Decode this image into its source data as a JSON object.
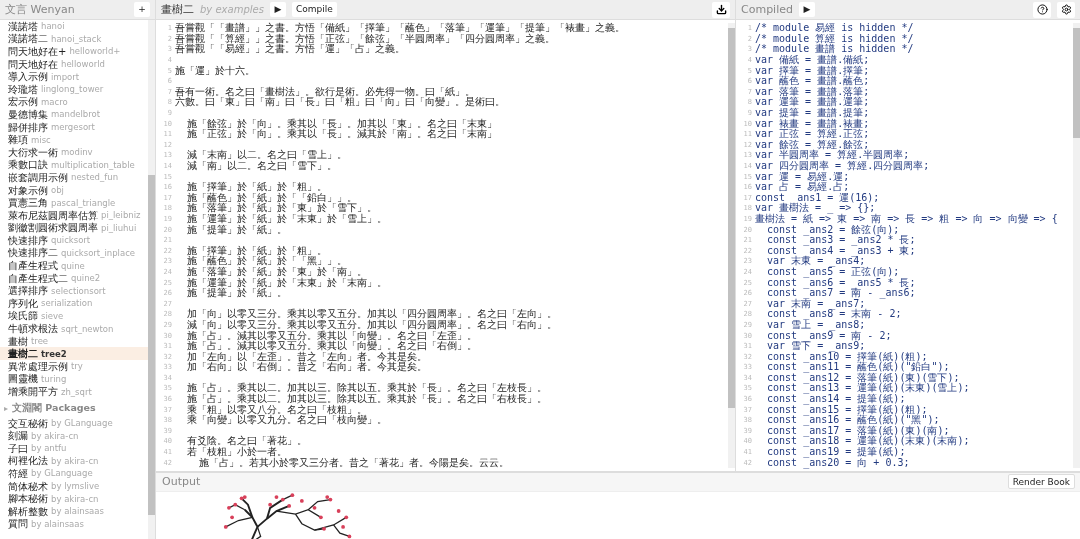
{
  "sidebar": {
    "title": "文言 Wenyan",
    "add_button": "+",
    "examples": [
      {
        "name": "漢諾塔",
        "slug": "hanoi",
        "selected": false
      },
      {
        "name": "漢諾塔二",
        "slug": "hanoi_stack",
        "selected": false
      },
      {
        "name": "問天地好在+",
        "slug": "helloworld+",
        "selected": false
      },
      {
        "name": "問天地好在",
        "slug": "helloworld",
        "selected": false
      },
      {
        "name": "導入示例",
        "slug": "import",
        "selected": false
      },
      {
        "name": "玲瓏塔",
        "slug": "linglong_tower",
        "selected": false
      },
      {
        "name": "宏示例",
        "slug": "macro",
        "selected": false
      },
      {
        "name": "曼德博集",
        "slug": "mandelbrot",
        "selected": false
      },
      {
        "name": "歸併排序",
        "slug": "mergesort",
        "selected": false
      },
      {
        "name": "雜項",
        "slug": "misc",
        "selected": false
      },
      {
        "name": "大衍求一術",
        "slug": "modinv",
        "selected": false
      },
      {
        "name": "乘數口訣",
        "slug": "multiplication_table",
        "selected": false
      },
      {
        "name": "嵌套調用示例",
        "slug": "nested_fun",
        "selected": false
      },
      {
        "name": "对象示例",
        "slug": "obj",
        "selected": false
      },
      {
        "name": "賈憲三角",
        "slug": "pascal_triangle",
        "selected": false
      },
      {
        "name": "萊布尼茲圓周率估算",
        "slug": "pi_leibniz",
        "selected": false
      },
      {
        "name": "劉徽割圓術求圓周率",
        "slug": "pi_liuhui",
        "selected": false
      },
      {
        "name": "快速排序",
        "slug": "quicksort",
        "selected": false
      },
      {
        "name": "快速排序二",
        "slug": "quicksort_inplace",
        "selected": false
      },
      {
        "name": "自產生程式",
        "slug": "quine",
        "selected": false
      },
      {
        "name": "自產生程式二",
        "slug": "quine2",
        "selected": false
      },
      {
        "name": "選擇排序",
        "slug": "selectionsort",
        "selected": false
      },
      {
        "name": "序列化",
        "slug": "serialization",
        "selected": false
      },
      {
        "name": "埃氏篩",
        "slug": "sieve",
        "selected": false
      },
      {
        "name": "牛頓求根法",
        "slug": "sqrt_newton",
        "selected": false
      },
      {
        "name": "畫樹",
        "slug": "tree",
        "selected": false
      },
      {
        "name": "畫樹二",
        "slug": "tree2",
        "selected": true
      },
      {
        "name": "異常處理示例",
        "slug": "try",
        "selected": false
      },
      {
        "name": "圖靈機",
        "slug": "turing",
        "selected": false
      },
      {
        "name": "增乘開平方",
        "slug": "zh_sqrt",
        "selected": false
      }
    ],
    "packages": {
      "toggle": "▸",
      "title": "文淵閣 Packages",
      "items": [
        {
          "name": "交互秘術",
          "author": "by GLanguage"
        },
        {
          "name": "刻漏",
          "author": "by akira-cn"
        },
        {
          "name": "子曰",
          "author": "by antfu"
        },
        {
          "name": "柯裡化法",
          "author": "by akira-cn"
        },
        {
          "name": "符經",
          "author": "by GLanguage"
        },
        {
          "name": "简体秘术",
          "author": "by lymslive"
        },
        {
          "name": "腳本秘術",
          "author": "by akira-cn"
        },
        {
          "name": "解析整數",
          "author": "by alainsaas"
        },
        {
          "name": "質問",
          "author": "by alainsaas"
        }
      ]
    }
  },
  "editor": {
    "title": "畫樹二",
    "author": "by examples",
    "run_button": "▶",
    "compile_button": "Compile",
    "lines": [
      {
        "no": "1",
        "text": "吾嘗觀「「畫譜」」之書。方悟「備紙」「擇筆」「蘸色」「落筆」「運筆」「提筆」「裱畫」之義。"
      },
      {
        "no": "2",
        "text": "吾嘗觀「「算經」」之書。方悟「正弦」「餘弦」「半圓周率」「四分圓周率」之義。"
      },
      {
        "no": "3",
        "text": "吾嘗觀「「易經」」之書。方悟「運」「占」之義。"
      },
      {
        "no": "4"
      },
      {
        "no": "5",
        "text": "施「運」於十六。"
      },
      {
        "no": "6"
      },
      {
        "no": "7",
        "text": "吾有一術。名之曰「畫樹法」。欲行是術。必先得一物。曰「紙」。"
      },
      {
        "no": "8",
        "text": "六數。曰「東」曰「南」曰「長」曰「粗」曰「向」曰「向變」。是術曰。"
      },
      {
        "no": "9"
      },
      {
        "no": "10",
        "text": "  施「餘弦」於「向」。乘其以「長」。加其以「東」。名之曰「末東」"
      },
      {
        "no": "11",
        "text": "  施「正弦」於「向」。乘其以「長」。減其於「南」。名之曰「末南」"
      },
      {
        "no": "12"
      },
      {
        "no": "13",
        "text": "  減「末南」以二。名之曰「雪上」。"
      },
      {
        "no": "14",
        "text": "  減「南」以二。名之曰「雪下」。"
      },
      {
        "no": "15"
      },
      {
        "no": "16",
        "text": "  施「擇筆」於「紙」於「粗」。"
      },
      {
        "no": "17",
        "text": "  施「蘸色」於「紙」於「「鉛白」」。"
      },
      {
        "no": "18",
        "text": "  施「落筆」於「紙」於「東」於「雪下」。"
      },
      {
        "no": "19",
        "text": "  施「運筆」於「紙」於「末東」於「雪上」。"
      },
      {
        "no": "20",
        "text": "  施「提筆」於「紙」。"
      },
      {
        "no": "21"
      },
      {
        "no": "22",
        "text": "  施「擇筆」於「紙」於「粗」。"
      },
      {
        "no": "23",
        "text": "  施「蘸色」於「紙」於「「黑」」。"
      },
      {
        "no": "24",
        "text": "  施「落筆」於「紙」於「東」於「南」。"
      },
      {
        "no": "25",
        "text": "  施「運筆」於「紙」於「末東」於「末南」。"
      },
      {
        "no": "26",
        "text": "  施「提筆」於「紙」。"
      },
      {
        "no": "27"
      },
      {
        "no": "28",
        "text": "  加「向」以零又三分。乘其以零又五分。加其以「四分圓周率」。名之曰「左向」。"
      },
      {
        "no": "29",
        "text": "  減「向」以零又三分。乘其以零又五分。加其以「四分圓周率」。名之曰「右向」。"
      },
      {
        "no": "30",
        "text": "  施「占」。減其以零又五分。乘其以「向變」。名之曰「左歪」。"
      },
      {
        "no": "31",
        "text": "  施「占」。減其以零又五分。乘其以「向變」。名之曰「右倒」。"
      },
      {
        "no": "32",
        "text": "  加「左向」以「左歪」。昔之「左向」者。今其是矣。"
      },
      {
        "no": "33",
        "text": "  加「右向」以「右倒」。昔之「右向」者。今其是矣。"
      },
      {
        "no": "34"
      },
      {
        "no": "35",
        "text": "  施「占」。乘其以二。加其以三。除其以五。乘其於「長」。名之曰「左枝長」。"
      },
      {
        "no": "36",
        "text": "  施「占」。乘其以二。加其以三。除其以五。乘其於「長」。名之曰「右枝長」。"
      },
      {
        "no": "37",
        "text": "  乘「粗」以零又八分。名之曰「枝粗」。"
      },
      {
        "no": "38",
        "text": "  乘「向變」以零又九分。名之曰「枝向變」。"
      },
      {
        "no": "39"
      },
      {
        "no": "40",
        "text": "  有爻陰。名之曰「著花」。"
      },
      {
        "no": "41",
        "text": "  若「枝粗」小於一者。"
      },
      {
        "no": "42",
        "text": "    施「占」。若其小於零又三分者。昔之「著花」者。今陽是矣。云云。"
      }
    ]
  },
  "compiled": {
    "title": "Compiled",
    "run_button": "▶",
    "lines": [
      {
        "no": "1",
        "text": "/* module 易經 is hidden */"
      },
      {
        "no": "2",
        "text": "/* module 算經 is hidden */"
      },
      {
        "no": "3",
        "text": "/* module 畫譜 is hidden */"
      },
      {
        "no": "4",
        "text": "var 備紙 = 畫譜.備紙;"
      },
      {
        "no": "5",
        "text": "var 擇筆 = 畫譜.擇筆;"
      },
      {
        "no": "6",
        "text": "var 蘸色 = 畫譜.蘸色;"
      },
      {
        "no": "7",
        "text": "var 落筆 = 畫譜.落筆;"
      },
      {
        "no": "8",
        "text": "var 運筆 = 畫譜.運筆;"
      },
      {
        "no": "9",
        "text": "var 提筆 = 畫譜.提筆;"
      },
      {
        "no": "10",
        "text": "var 裱畫 = 畫譜.裱畫;"
      },
      {
        "no": "11",
        "text": "var 正弦 = 算經.正弦;"
      },
      {
        "no": "12",
        "text": "var 餘弦 = 算經.餘弦;"
      },
      {
        "no": "13",
        "text": "var 半圓周率 = 算經.半圓周率;"
      },
      {
        "no": "14",
        "text": "var 四分圓周率 = 算經.四分圓周率;"
      },
      {
        "no": "15",
        "text": "var 運 = 易經.運;"
      },
      {
        "no": "16",
        "text": "var 占 = 易經.占;"
      },
      {
        "no": "17",
        "text": "const _ans1 = 運(16);"
      },
      {
        "no": "18",
        "text": "var 畫樹法 = _ => {};"
      },
      {
        "no": "19",
        "text": "畫樹法 = 紙 => 東 => 南 => 長 => 粗 => 向 => 向變 => {"
      },
      {
        "no": "20",
        "text": "  const _ans2 = 餘弦(向);"
      },
      {
        "no": "21",
        "text": "  const _ans3 = _ans2 * 長;"
      },
      {
        "no": "22",
        "text": "  const _ans4 = _ans3 + 東;"
      },
      {
        "no": "23",
        "text": "  var 末東 = _ans4;"
      },
      {
        "no": "24",
        "text": "  const _ans5 = 正弦(向);"
      },
      {
        "no": "25",
        "text": "  const _ans6 = _ans5 * 長;"
      },
      {
        "no": "26",
        "text": "  const _ans7 = 南 - _ans6;"
      },
      {
        "no": "27",
        "text": "  var 末南 = _ans7;"
      },
      {
        "no": "28",
        "text": "  const _ans8 = 末南 - 2;"
      },
      {
        "no": "29",
        "text": "  var 雪上 = _ans8;"
      },
      {
        "no": "30",
        "text": "  const _ans9 = 南 - 2;"
      },
      {
        "no": "31",
        "text": "  var 雪下 = _ans9;"
      },
      {
        "no": "32",
        "text": "  const _ans10 = 擇筆(紙)(粗);"
      },
      {
        "no": "33",
        "text": "  const _ans11 = 蘸色(紙)(\"鉛白\");"
      },
      {
        "no": "34",
        "text": "  const _ans12 = 落筆(紙)(東)(雪下);"
      },
      {
        "no": "35",
        "text": "  const _ans13 = 運筆(紙)(末東)(雪上);"
      },
      {
        "no": "36",
        "text": "  const _ans14 = 提筆(紙);"
      },
      {
        "no": "37",
        "text": "  const _ans15 = 擇筆(紙)(粗);"
      },
      {
        "no": "38",
        "text": "  const _ans16 = 蘸色(紙)(\"黑\");"
      },
      {
        "no": "39",
        "text": "  const _ans17 = 落筆(紙)(東)(南);"
      },
      {
        "no": "40",
        "text": "  const _ans18 = 運筆(紙)(末東)(末南);"
      },
      {
        "no": "41",
        "text": "  const _ans19 = 提筆(紙);"
      },
      {
        "no": "42",
        "text": "  const _ans20 = 向 + 0.3;"
      }
    ]
  },
  "output": {
    "title": "Output",
    "render_button": "Render Book"
  }
}
